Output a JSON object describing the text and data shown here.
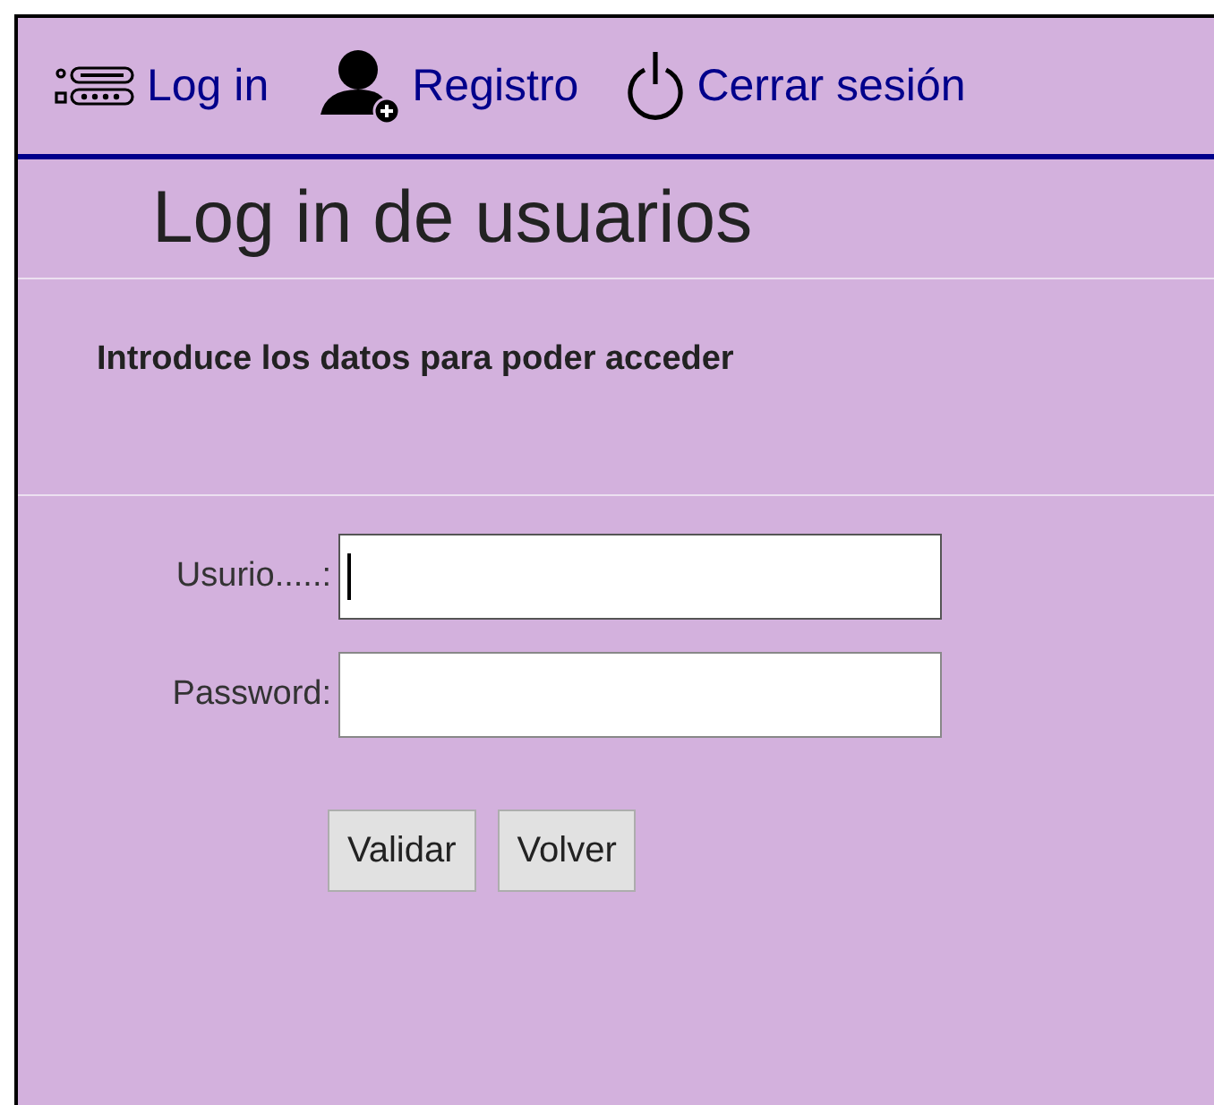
{
  "nav": [
    {
      "kind": "login",
      "label": "Log in"
    },
    {
      "kind": "register",
      "label": "Registro"
    },
    {
      "kind": "logout",
      "label": "Cerrar sesión"
    }
  ],
  "heading": "Log in de usuarios",
  "instructions": "Introduce los datos para poder acceder",
  "fields": [
    {
      "label": "Usurio.....:",
      "focused": true
    },
    {
      "label": "Password:",
      "focused": false
    }
  ],
  "buttons": [
    "Validar",
    "Volver"
  ]
}
